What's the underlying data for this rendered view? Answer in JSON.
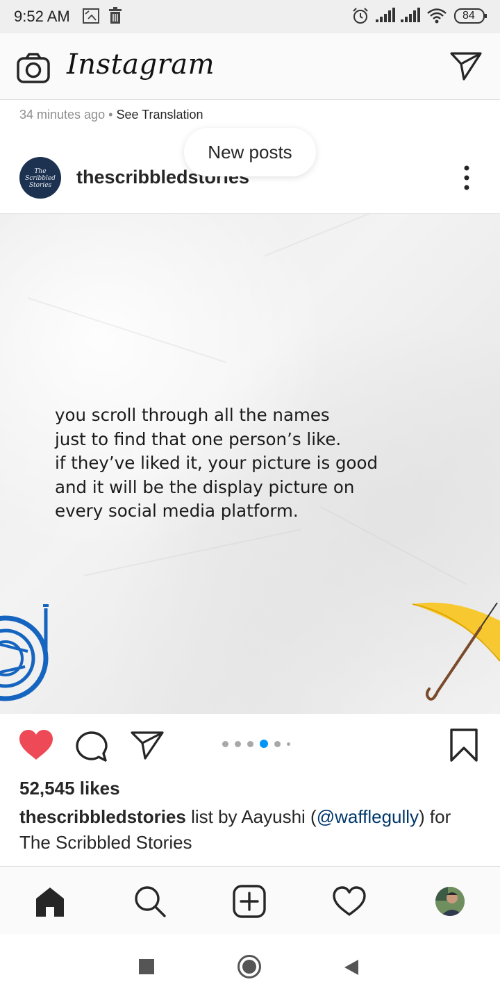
{
  "status_bar": {
    "time": "9:52 AM",
    "battery": "84",
    "icons": [
      "picture-icon",
      "trash-icon",
      "alarm-icon",
      "signal-icon",
      "signal-icon",
      "wifi-icon",
      "battery-icon"
    ]
  },
  "top_bar": {
    "brand": "Instagram",
    "left_icon": "camera-icon",
    "right_icon": "direct-send-icon"
  },
  "post_meta": {
    "time_ago": "34 minutes ago",
    "separator": "•",
    "see_translation": "See Translation"
  },
  "new_posts_pill": "New posts",
  "post": {
    "author": {
      "username": "thescribbledstories",
      "avatar_lines": [
        "The",
        "Scribbled",
        "Stories"
      ]
    },
    "image_text": [
      "you scroll through all the names",
      "just to find that one person’s like.",
      "if they’ve liked it, your picture is good",
      "and it will be the display picture on",
      "every social media platform."
    ],
    "carousel": {
      "count": 5,
      "active_index": 3
    },
    "liked": true,
    "likes": "52,545 likes",
    "caption": {
      "username": "thescribbledstories",
      "text_before": " list by Aayushi (",
      "mention": "@wafflegully",
      "text_after": ") for The Scribbled Stories"
    }
  },
  "colors": {
    "like_red": "#ed4956",
    "accent_blue": "#0095f6",
    "mention_blue": "#00376b",
    "avatar_navy": "#1d3150",
    "horn_blue": "#1565c0",
    "umbrella_yellow": "#f7c830"
  },
  "bottom_nav": [
    "home-icon",
    "search-icon",
    "new-post-icon",
    "activity-heart-icon",
    "profile-avatar"
  ],
  "system_nav": [
    "recents-square-icon",
    "home-circle-icon",
    "back-triangle-icon"
  ]
}
